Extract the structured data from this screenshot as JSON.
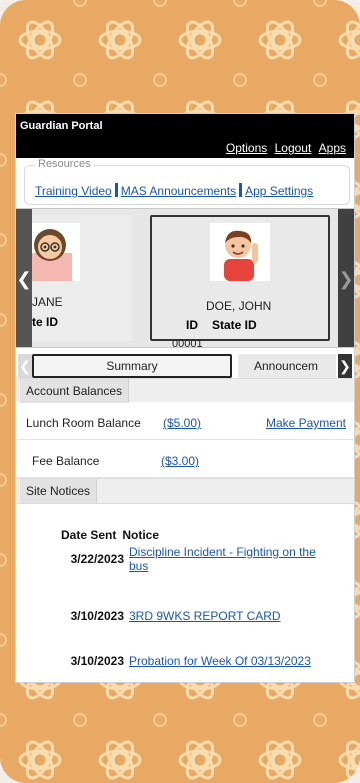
{
  "app": {
    "title": "Guardian Portal"
  },
  "header_links": {
    "options": "Options",
    "logout": "Logout",
    "apps": "Apps"
  },
  "resources": {
    "legend": "Resources",
    "links": [
      "Training Video",
      "MAS Announcements",
      "App Settings"
    ]
  },
  "students": [
    {
      "name": "JANE",
      "id_label": "te ID"
    },
    {
      "name": "DOE, JOHN",
      "id_label": "ID",
      "state_id_label": "State ID",
      "id_value": "00001"
    }
  ],
  "tabs": [
    "Summary",
    "Announcem"
  ],
  "account": {
    "section_label": "Account Balances",
    "lunch_label": "Lunch Room Balance",
    "lunch_amount": "($5.00)",
    "make_payment": "Make Payment",
    "fee_label": "Fee Balance",
    "fee_amount": "($3.00)"
  },
  "notices": {
    "section_label": "Site Notices",
    "col_date": "Date Sent",
    "col_notice": "Notice",
    "items": [
      {
        "date": "3/22/2023",
        "text": "Discipline Incident - Fighting on the bus"
      },
      {
        "date": "3/10/2023",
        "text": "3RD 9WKS REPORT CARD"
      },
      {
        "date": "3/10/2023",
        "text": "Probation for Week Of 03/13/2023"
      }
    ]
  },
  "colors": {
    "header": "#000000",
    "link": "#1b57a9",
    "pattern_bg": "#e6a863",
    "pattern_line": "#f5d8a9"
  },
  "icons": {
    "left": "chevron-left-icon",
    "right": "chevron-right-icon"
  }
}
